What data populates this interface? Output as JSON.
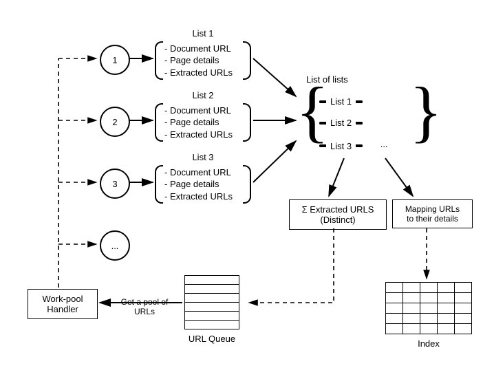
{
  "nodes": {
    "worker1": "1",
    "worker2": "2",
    "worker3": "3",
    "workerMore": "..."
  },
  "lists": {
    "l1": {
      "title": "List 1",
      "a": "- Document URL",
      "b": "- Page details",
      "c": "- Extracted URLs"
    },
    "l2": {
      "title": "List 2",
      "a": "- Document URL",
      "b": "- Page details",
      "c": "- Extracted URLs"
    },
    "l3": {
      "title": "List 3",
      "a": "- Document URL",
      "b": "- Page details",
      "c": "- Extracted URLs"
    }
  },
  "agg": {
    "title": "List of lists",
    "p1": "List 1",
    "p2": "List 2",
    "p3": "List 3",
    "p4": "..."
  },
  "out": {
    "sumBox": "Σ Extracted URLS\n(Distinct)",
    "mapBox": "Mapping URLs\nto their details"
  },
  "handler": "Work-pool\nHandler",
  "edgeLabel": "Get a pool of\nURLs",
  "queueLabel": "URL Queue",
  "indexLabel": "Index"
}
